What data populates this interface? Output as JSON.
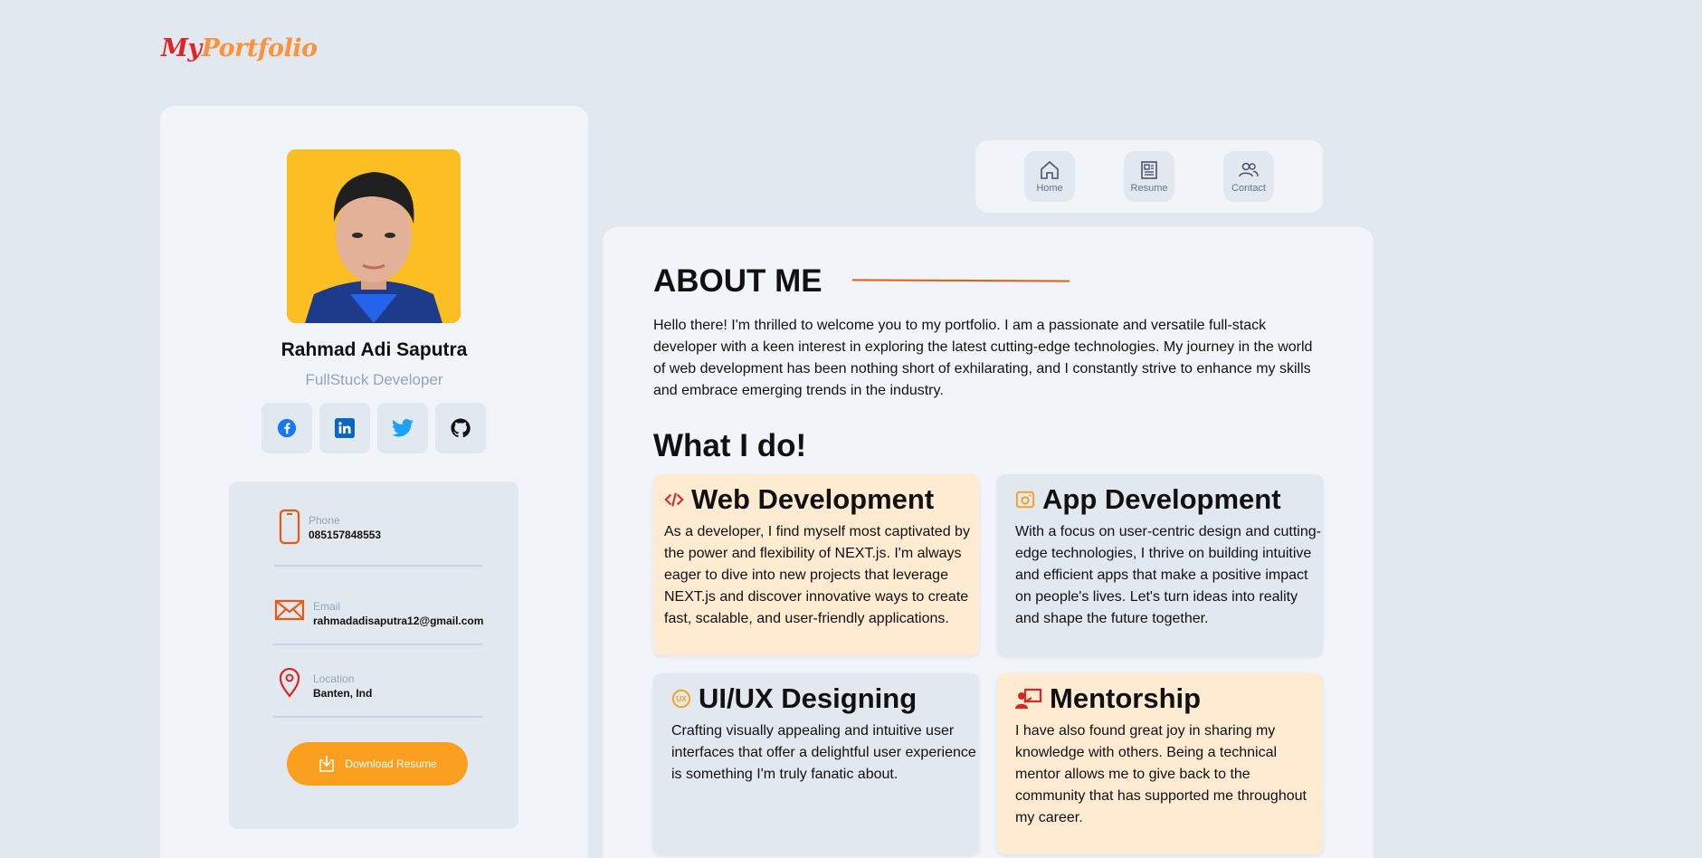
{
  "logo": {
    "part1": "My",
    "part2": "Portfolio"
  },
  "profile": {
    "name": "Rahmad Adi Saputra",
    "role": "FullStuck Developer",
    "socials": [
      "facebook",
      "linkedin",
      "twitter",
      "github"
    ],
    "contacts": [
      {
        "label": "Phone",
        "value": "085157848553",
        "icon": "phone-icon"
      },
      {
        "label": "Email",
        "value": "rahmadadisaputra12@gmail.com",
        "icon": "mail-icon"
      },
      {
        "label": "Location",
        "value": "Banten, Ind",
        "icon": "location-icon"
      }
    ],
    "download_label": "Download Resume"
  },
  "nav": {
    "home": "Home",
    "resume": "Resume",
    "contact": "Contact"
  },
  "about": {
    "title": "ABOUT ME",
    "text": "Hello there! I'm thrilled to welcome you to my portfolio. I am a passionate and versatile full-stack developer with a keen interest in exploring the latest cutting-edge technologies. My journey in the world of web development has been nothing short of exhilarating, and I constantly strive to enhance my skills and embrace emerging trends in the industry."
  },
  "what_i_do": {
    "title": "What I do!",
    "services": [
      {
        "title": "Web Development",
        "icon": "code-icon",
        "text": "As a developer, I find myself most captivated by the power and flexibility of NEXT.js. I'm always eager to dive into new projects that leverage NEXT.js and discover innovative ways to create fast, scalable, and user-friendly applications."
      },
      {
        "title": "App Development",
        "icon": "app-icon",
        "text": "With a focus on user-centric design and cutting-edge technologies, I thrive on building intuitive and efficient apps that make a positive impact on people's lives. Let's turn ideas into reality and shape the future together."
      },
      {
        "title": "UI/UX Designing",
        "icon": "ux-icon",
        "text": "Crafting visually appealing and intuitive user interfaces that offer a delightful user experience is something I'm truly fanatic about."
      },
      {
        "title": "Mentorship",
        "icon": "mentor-icon",
        "text": "I have also found great joy in sharing my knowledge with others. Being a technical mentor allows me to give back to the community that has supported me throughout my career."
      }
    ]
  },
  "colors": {
    "accent": "#fb9f1f",
    "logo_red": "#dc2626",
    "peach": "#feebd1",
    "bg": "#e2e8f0"
  }
}
